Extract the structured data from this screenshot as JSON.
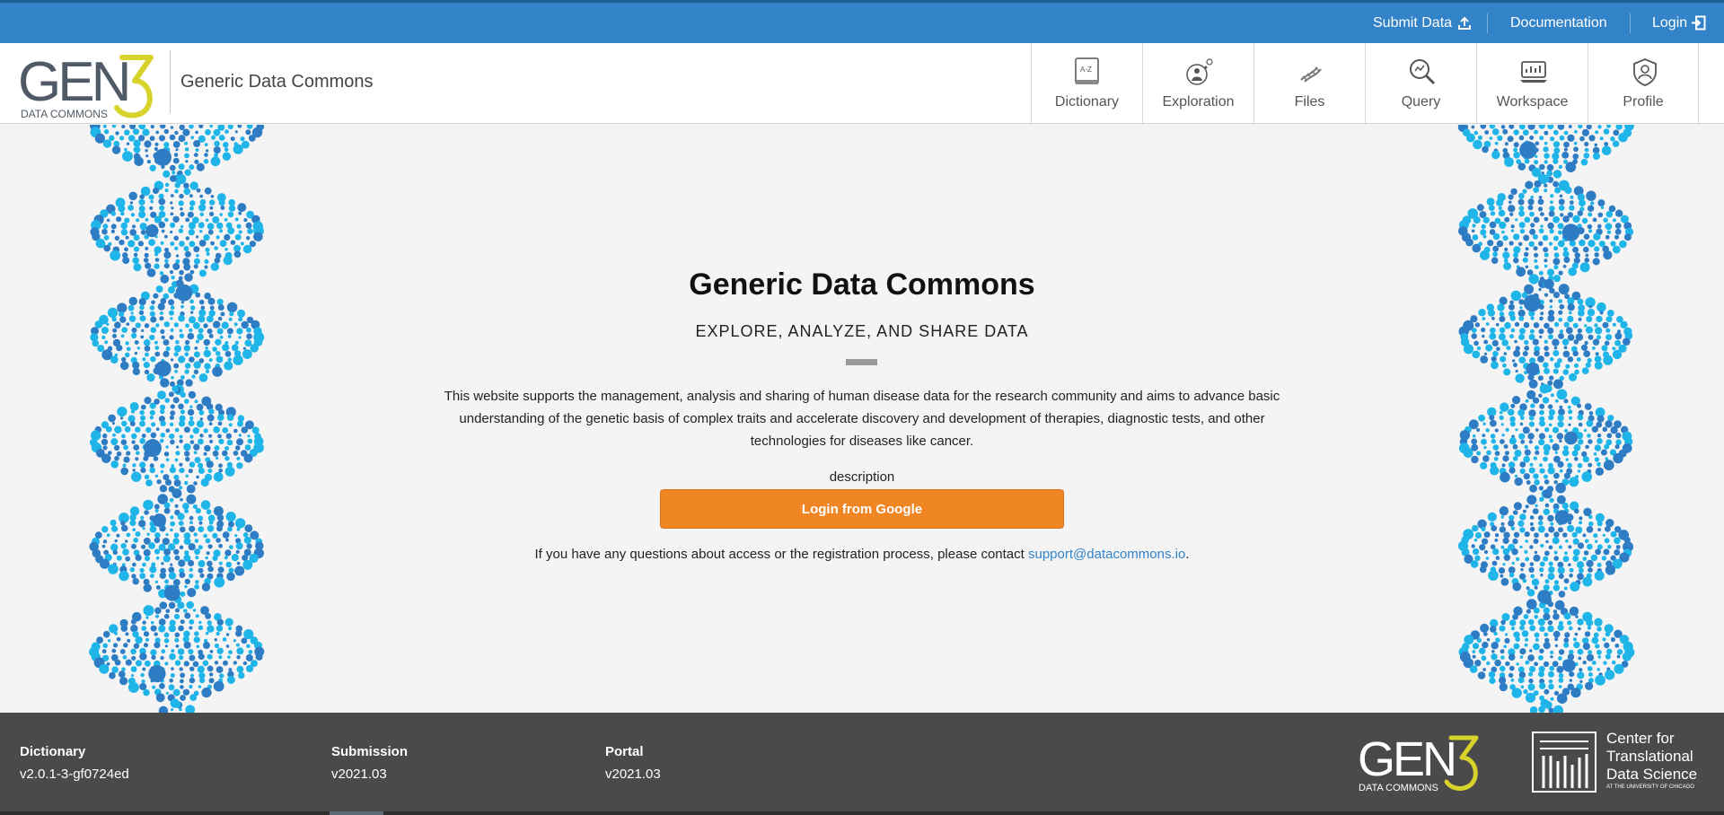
{
  "topbar": {
    "submit_data": "Submit Data",
    "documentation": "Documentation",
    "login": "Login"
  },
  "header": {
    "logo_alt": "GEN3 DATA COMMONS",
    "title": "Generic Data Commons",
    "nav": [
      {
        "label": "Dictionary",
        "icon": "dictionary-icon"
      },
      {
        "label": "Exploration",
        "icon": "exploration-icon"
      },
      {
        "label": "Files",
        "icon": "files-icon"
      },
      {
        "label": "Query",
        "icon": "query-icon"
      },
      {
        "label": "Workspace",
        "icon": "workspace-icon"
      },
      {
        "label": "Profile",
        "icon": "profile-icon"
      }
    ]
  },
  "main": {
    "title": "Generic Data Commons",
    "subtitle": "EXPLORE, ANALYZE, AND SHARE DATA",
    "description": "This website supports the management, analysis and sharing of human disease data for the research community and aims to advance basic understanding of the genetic basis of complex traits and accelerate discovery and development of therapies, diagnostic tests, and other technologies for diseases like cancer.",
    "description_label": "description",
    "login_button": "Login from Google",
    "contact_prefix": "If you have any questions about access or the registration process, please contact ",
    "contact_email": "support@datacommons.io",
    "contact_suffix": "."
  },
  "footer": {
    "dictionary_label": "Dictionary",
    "dictionary_version": "v2.0.1-3-gf0724ed",
    "submission_label": "Submission",
    "submission_version": "v2021.03",
    "portal_label": "Portal",
    "portal_version": "v2021.03",
    "ctds_line1": "Center for",
    "ctds_line2": "Translational",
    "ctds_line3": "Data Science",
    "ctds_line4": "AT THE UNIVERSITY OF CHICAGO"
  },
  "colors": {
    "topbar": "#3283c8",
    "button": "#ef8523",
    "footer": "#4a4a4a",
    "gen3_yellow": "#d8d32a",
    "dna_dark": "#2e7cc4",
    "dna_light": "#1fb5e8"
  }
}
